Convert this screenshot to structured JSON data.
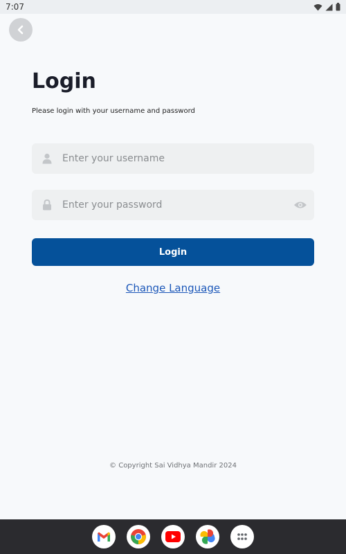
{
  "status_bar": {
    "time": "7:07"
  },
  "login": {
    "title": "Login",
    "subtitle": "Please login with your username and password",
    "username_placeholder": "Enter your username",
    "password_placeholder": "Enter your password",
    "button_label": "Login",
    "change_language": "Change Language"
  },
  "footer": {
    "copyright": "© Copyright Sai Vidhya Mandir 2024"
  },
  "dock": {
    "apps": [
      "gmail-icon",
      "chrome-icon",
      "youtube-icon",
      "photos-icon",
      "app-drawer-icon"
    ]
  },
  "colors": {
    "primary": "#05519a",
    "link": "#1a56b8",
    "background": "#f7f9fb",
    "field_bg": "#eef0f1",
    "dock_bg": "#2b2b2f"
  }
}
